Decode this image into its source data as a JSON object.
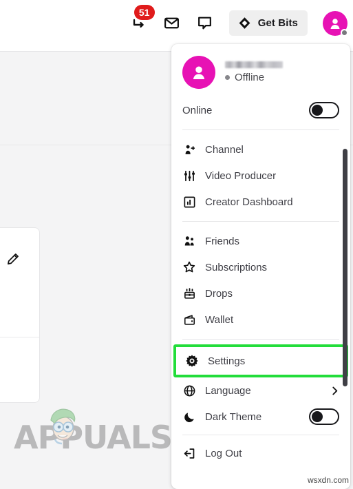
{
  "topbar": {
    "notifications": {
      "icon": "notifications-icon",
      "badge_count": "51"
    },
    "inbox": {
      "icon": "inbox-icon"
    },
    "whispers": {
      "icon": "chat-bubble-icon"
    },
    "get_bits": {
      "label": "Get Bits",
      "icon": "bits-diamond-icon"
    },
    "avatar": {
      "icon": "user-avatar-icon",
      "status": "offline"
    }
  },
  "background": {
    "left_card": {
      "icon": "pencil-edit-icon"
    }
  },
  "menu": {
    "account": {
      "username": "",
      "status_label": "Offline",
      "avatar_icon": "user-avatar-icon"
    },
    "online_toggle": {
      "label": "Online",
      "state": "off"
    },
    "group_creator": [
      {
        "label": "Channel",
        "icon": "person-channel-icon"
      },
      {
        "label": "Video Producer",
        "icon": "sliders-icon"
      },
      {
        "label": "Creator Dashboard",
        "icon": "dashboard-chart-icon"
      }
    ],
    "group_social": [
      {
        "label": "Friends",
        "icon": "friends-icon"
      },
      {
        "label": "Subscriptions",
        "icon": "star-icon"
      },
      {
        "label": "Drops",
        "icon": "drops-chest-icon"
      },
      {
        "label": "Wallet",
        "icon": "wallet-icon"
      }
    ],
    "settings": {
      "label": "Settings",
      "icon": "gear-icon",
      "highlight_color": "#22dd3a"
    },
    "language": {
      "label": "Language",
      "icon": "globe-icon",
      "chevron": "chevron-right-icon"
    },
    "dark_theme": {
      "label": "Dark Theme",
      "icon": "moon-icon",
      "state": "off"
    },
    "log_out": {
      "label": "Log Out",
      "icon": "logout-icon"
    }
  },
  "watermarks": {
    "brand": "APPUALS",
    "site": "wsxdn.com"
  }
}
